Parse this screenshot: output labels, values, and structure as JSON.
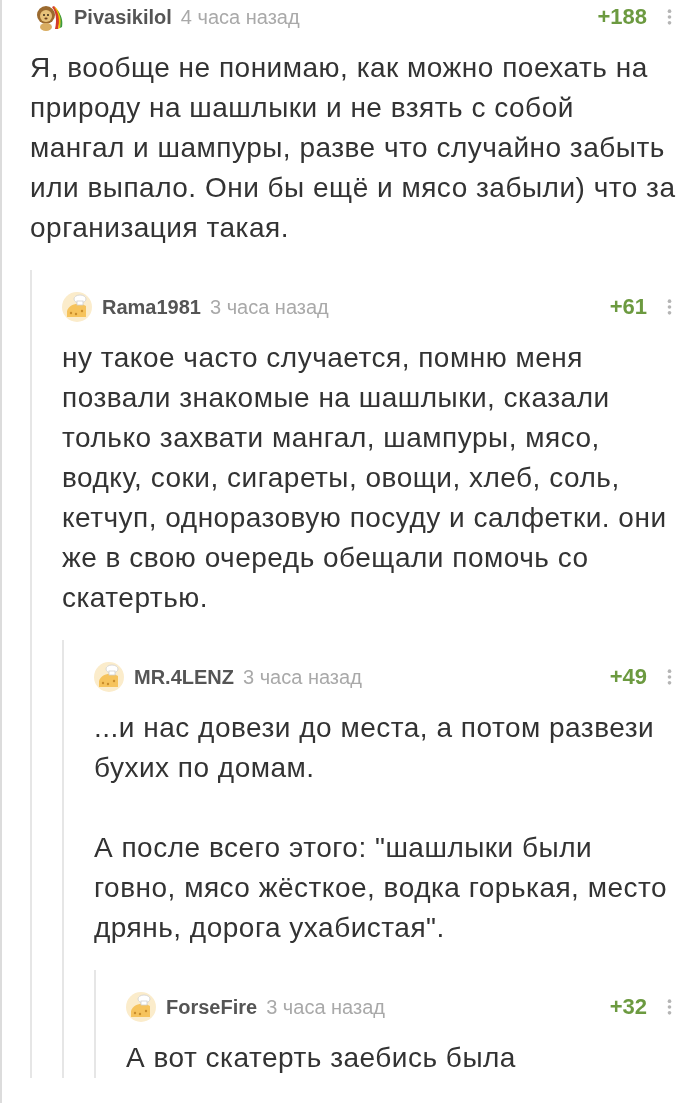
{
  "comments": [
    {
      "author": "Pivasikilol",
      "kind": "custom",
      "time": "4 часа назад",
      "rating": "+188",
      "paragraphs": [
        "Я, вообще не понимаю, как можно поехать на природу на шашлыки и не взять с собой мангал и шампуры, разве что случайно забыть или выпало. Они бы ещё и мясо забыли) что за организация такая."
      ],
      "children": [
        {
          "author": "Rama1981",
          "kind": "default",
          "time": "3 часа назад",
          "rating": "+61",
          "paragraphs": [
            "ну такое часто случается, помню меня позвали знакомые на шашлыки, сказали только захвати мангал, шампуры, мясо, водку, соки, сигареты, овощи, хлеб, соль, кетчуп, одноразовую посуду и салфетки. они же в свою очередь обещали помочь со скатертью."
          ],
          "children": [
            {
              "author": "MR.4LENZ",
              "kind": "default",
              "time": "3 часа назад",
              "rating": "+49",
              "paragraphs": [
                "...и нас довези до места, а потом развези бухих по домам.",
                "А после всего этого: \"шашлыки были говно, мясо жёсткое, водка горькая, место дрянь, дорога ухабистая\"."
              ],
              "children": [
                {
                  "author": "ForseFire",
                  "kind": "default",
                  "time": "3 часа назад",
                  "rating": "+32",
                  "paragraphs": [
                    "А вот скатерть заебись была"
                  ]
                }
              ]
            }
          ]
        }
      ]
    }
  ]
}
